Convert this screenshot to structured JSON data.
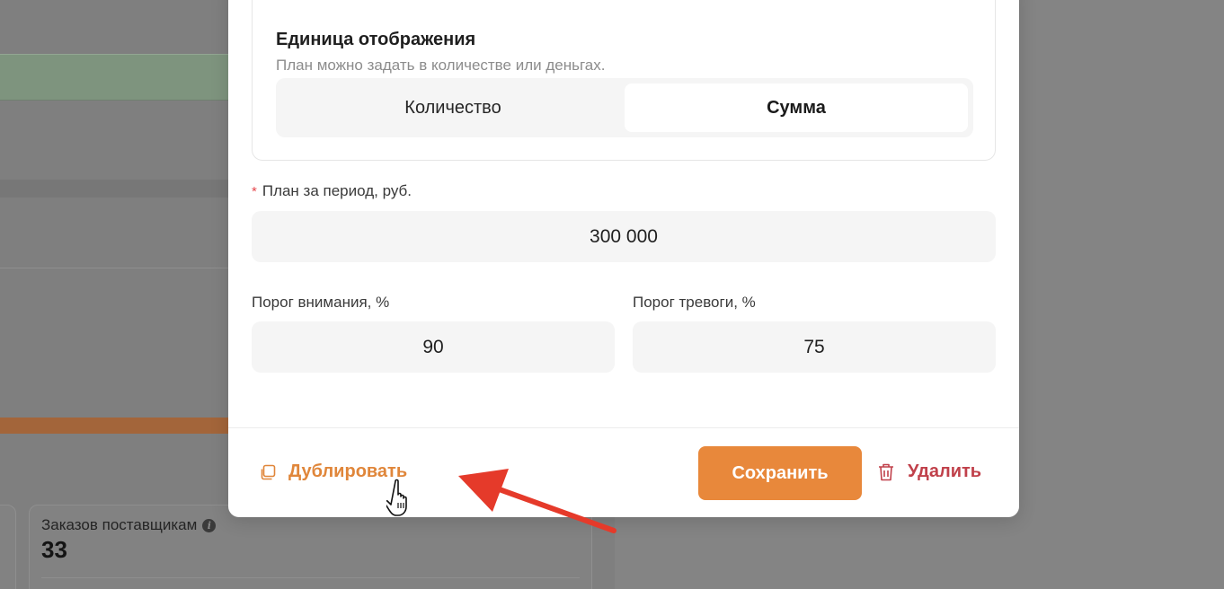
{
  "background": {
    "card": {
      "title": "Заказов поставщикам",
      "value": "33"
    }
  },
  "modal": {
    "unit": {
      "title": "Единица отображения",
      "subtitle": "План можно задать в количестве или деньгах.",
      "options": [
        "Количество",
        "Сумма"
      ],
      "selected": "Сумма"
    },
    "plan": {
      "label": "План за период, руб.",
      "required_mark": "*",
      "value": "300 000"
    },
    "attention": {
      "label": "Порог внимания, %",
      "value": "90"
    },
    "alarm": {
      "label": "Порог тревоги, %",
      "value": "75"
    },
    "footer": {
      "duplicate_label": "Дублировать",
      "save_label": "Сохранить",
      "delete_label": "Удалить"
    }
  },
  "colors": {
    "accent": "#e8883b",
    "danger": "#c0404a",
    "annotation_arrow": "#e53a2a"
  },
  "icons": [
    "info-icon",
    "copy-icon",
    "trash-icon",
    "hand-pointer-icon"
  ]
}
